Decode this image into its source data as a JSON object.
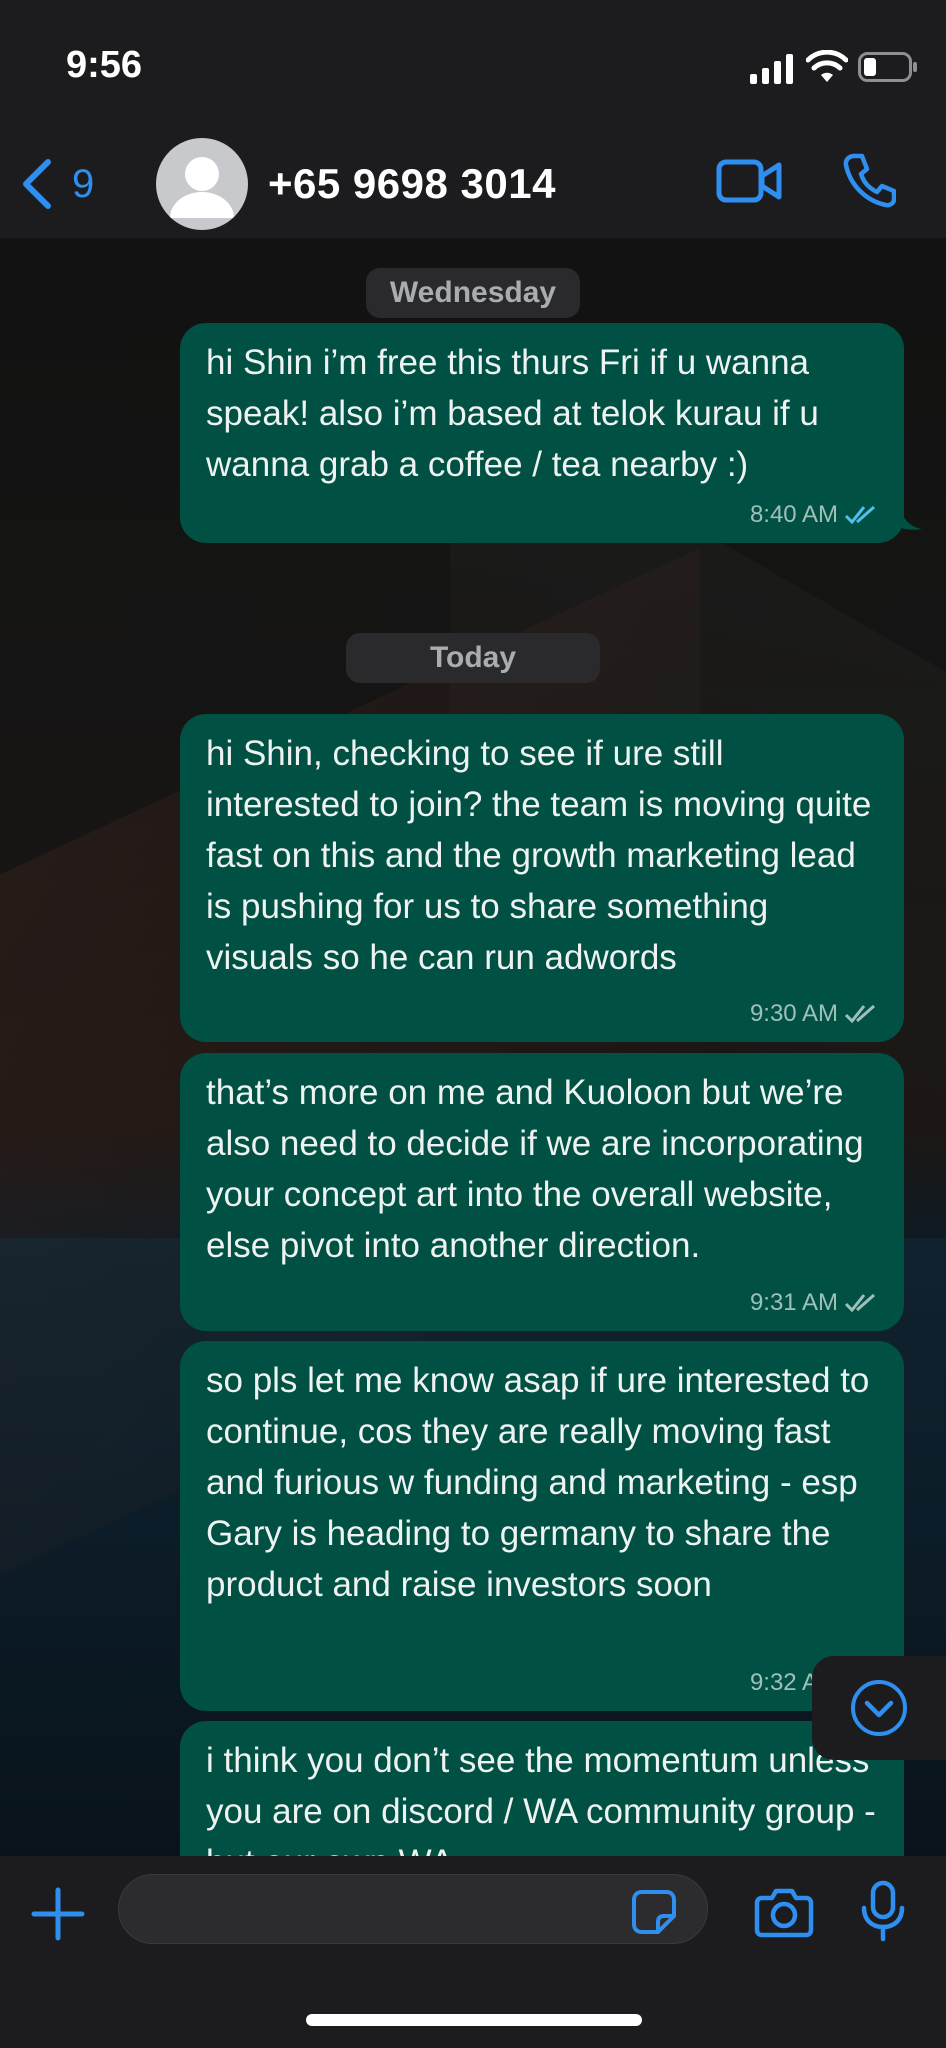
{
  "status_bar": {
    "time": "9:56"
  },
  "header": {
    "back_count": "9",
    "contact_name": "+65 9698 3014"
  },
  "date_separators": [
    "Wednesday",
    "Today"
  ],
  "messages": [
    {
      "text": "hi Shin i’m free this thurs Fri if u wanna speak! also i’m based at telok kurau if u wanna grab a coffee / tea nearby :)",
      "time": "8:40 AM",
      "read": true
    },
    {
      "text": "hi Shin, checking to see if ure still interested to join? the team is moving quite fast on this and the growth marketing lead is pushing for us to share something visuals so he can run adwords",
      "time": "9:30 AM",
      "read": false
    },
    {
      "text": "that’s more on me and Kuoloon but we’re also need to decide if we are incorporating your concept art into the overall website, else pivot into another direction.",
      "time": "9:31 AM",
      "read": false
    },
    {
      "text": "so pls let me know asap if ure interested to continue, cos they are really moving fast and furious w funding and marketing - esp Gary is heading to germany to share the product and raise investors soon",
      "time": "9:32 AM",
      "read": false
    },
    {
      "text": "i think you don’t see the momentum unless you are on discord / WA community group - but our own WA",
      "time": "",
      "read": false
    }
  ],
  "input": {
    "placeholder": "",
    "value": ""
  },
  "colors": {
    "accent": "#2f8ff0",
    "bubble_out": "#005143",
    "read_tick": "#53bdeb"
  },
  "icons": [
    "back-chevron-icon",
    "avatar-icon",
    "video-call-icon",
    "voice-call-icon",
    "scroll-down-icon",
    "plus-icon",
    "sticker-icon",
    "camera-icon",
    "microphone-icon"
  ]
}
